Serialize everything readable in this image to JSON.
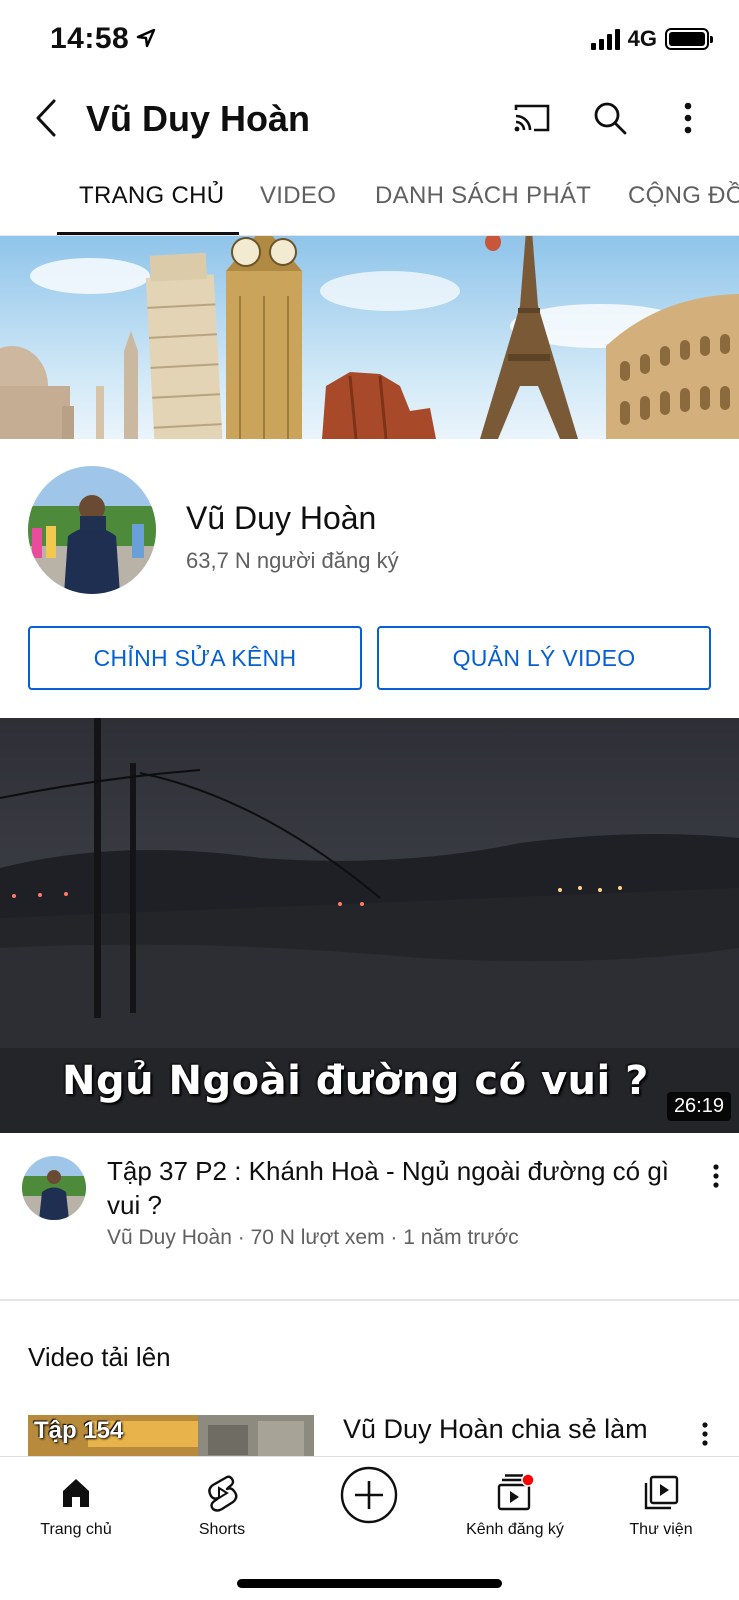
{
  "status_bar": {
    "time": "14:58",
    "network": "4G"
  },
  "header": {
    "title": "Vũ Duy Hoàn"
  },
  "tabs": [
    {
      "label": "TRANG CHỦ"
    },
    {
      "label": "VIDEO"
    },
    {
      "label": "DANH SÁCH PHÁT"
    },
    {
      "label": "CỘNG ĐỒ"
    }
  ],
  "channel": {
    "name": "Vũ Duy Hoàn",
    "subscribers": "63,7 N người đăng ký",
    "edit_button": "CHỈNH SỬA KÊNH",
    "manage_button": "QUẢN LÝ VIDEO"
  },
  "featured_video": {
    "overlay_text": "Ngủ Ngoài đường có vui ?",
    "duration": "26:19",
    "title": "Tập 37 P2 : Khánh Hoà - Ngủ ngoài đường có gì vui ?",
    "meta": "Vũ Duy Hoàn · 70 N lượt xem · 1 năm trước"
  },
  "uploads": {
    "section_title": "Video tải lên",
    "items": [
      {
        "episode_label": "Tập 154",
        "title": "Vũ Duy Hoàn chia sẻ làm"
      }
    ]
  },
  "bottom_nav": [
    {
      "label": "Trang chủ",
      "icon": "home-icon"
    },
    {
      "label": "Shorts",
      "icon": "shorts-icon"
    },
    {
      "label": "",
      "icon": "create-icon"
    },
    {
      "label": "Kênh đăng ký",
      "icon": "subscriptions-icon"
    },
    {
      "label": "Thư viện",
      "icon": "library-icon"
    }
  ],
  "colors": {
    "accent": "#065fd4",
    "notification": "#ff0000"
  }
}
